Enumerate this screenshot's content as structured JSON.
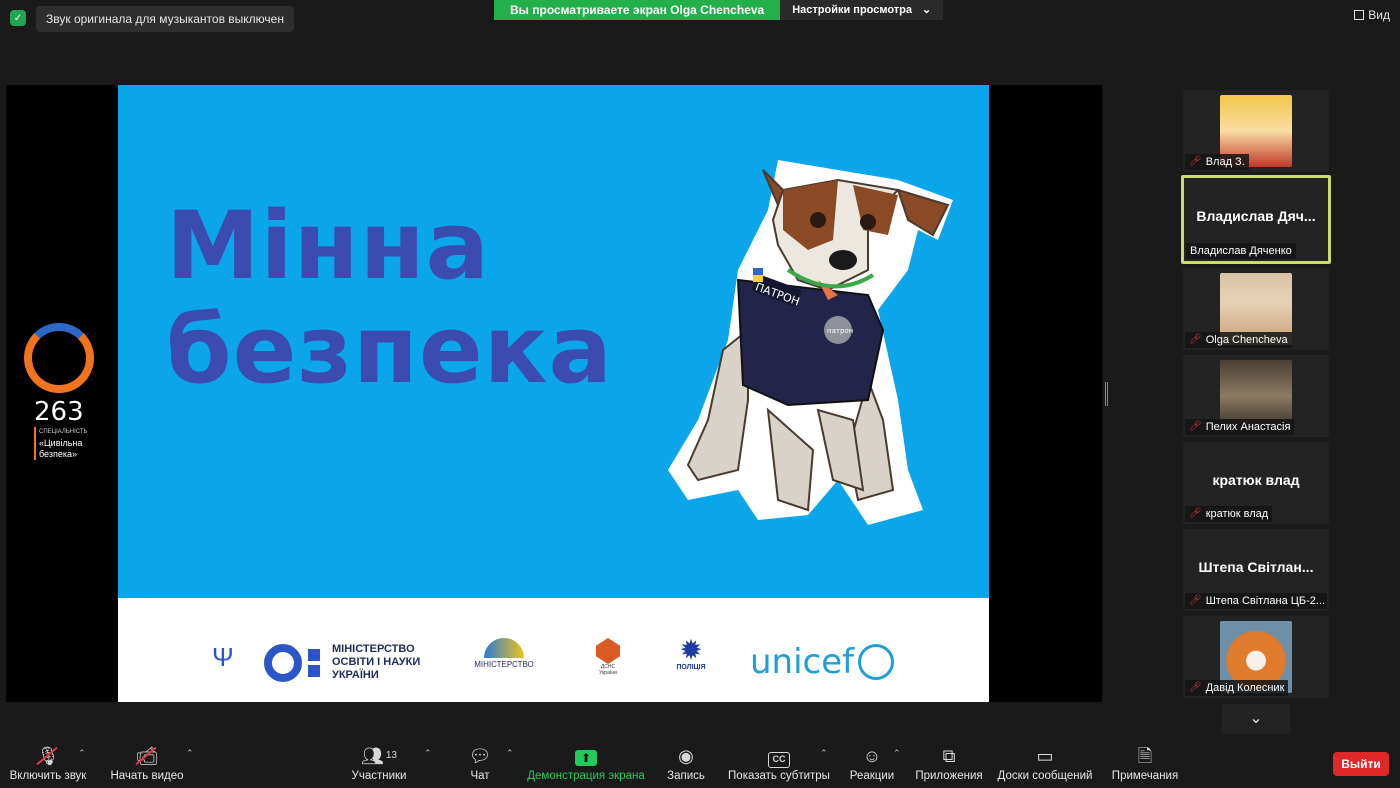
{
  "topbar": {
    "audio_notice": "Звук оригинала для музыкантов выключен",
    "sharing_banner": "Вы просматриваете экран Olga Chencheva",
    "view_settings": "Настройки просмотра",
    "view_button": "Вид"
  },
  "slide": {
    "title_line1": "Мінна",
    "title_line2": "безпека",
    "dog_tag_name": "ПАТРОН",
    "dog_tag_medal": "патрон",
    "footer": {
      "mon_text": "МІНІСТЕРСТВО ОСВІТИ І НАУКИ УКРАЇНИ",
      "min_reintegration": "МІНІСТЕРСТВО",
      "dsns": "ДСНС України",
      "police": "ПОЛІЦІЯ",
      "unicef": "unicef"
    }
  },
  "left_logo": {
    "number": "263",
    "line1": "СПЕЦІАЛЬНІСТЬ",
    "line2": "«Цивільна",
    "line3": "безпека»"
  },
  "participants": [
    {
      "name": "Влад З.",
      "muted": true,
      "type": "avatar",
      "avatar": "anime"
    },
    {
      "name": "Владислав Дяченко",
      "big_name": "Владислав  Дяч...",
      "muted": false,
      "type": "text",
      "active": true
    },
    {
      "name": "Olga Chencheva",
      "muted": true,
      "type": "avatar",
      "avatar": "woman"
    },
    {
      "name": "Пелих Анастасія",
      "muted": true,
      "type": "avatar",
      "avatar": "room"
    },
    {
      "name": "кратюк влад",
      "big_name": "кратюк влад",
      "muted": true,
      "type": "text"
    },
    {
      "name": "Штепа Світлана ЦБ-2...",
      "big_name": "Штепа  Світлан...",
      "muted": true,
      "type": "text"
    },
    {
      "name": "Давід Колесник",
      "muted": true,
      "type": "avatar",
      "avatar": "fox"
    }
  ],
  "toolbar": {
    "unmute": "Включить звук",
    "start_video": "Начать видео",
    "participants": "Участники",
    "participants_count": "13",
    "chat": "Чат",
    "share_screen": "Демонстрация экрана",
    "record": "Запись",
    "captions": "Показать субтитры",
    "captions_icon": "CC",
    "reactions": "Реакции",
    "apps": "Приложения",
    "whiteboards": "Доски сообщений",
    "notes": "Примечания",
    "leave": "Выйти"
  }
}
